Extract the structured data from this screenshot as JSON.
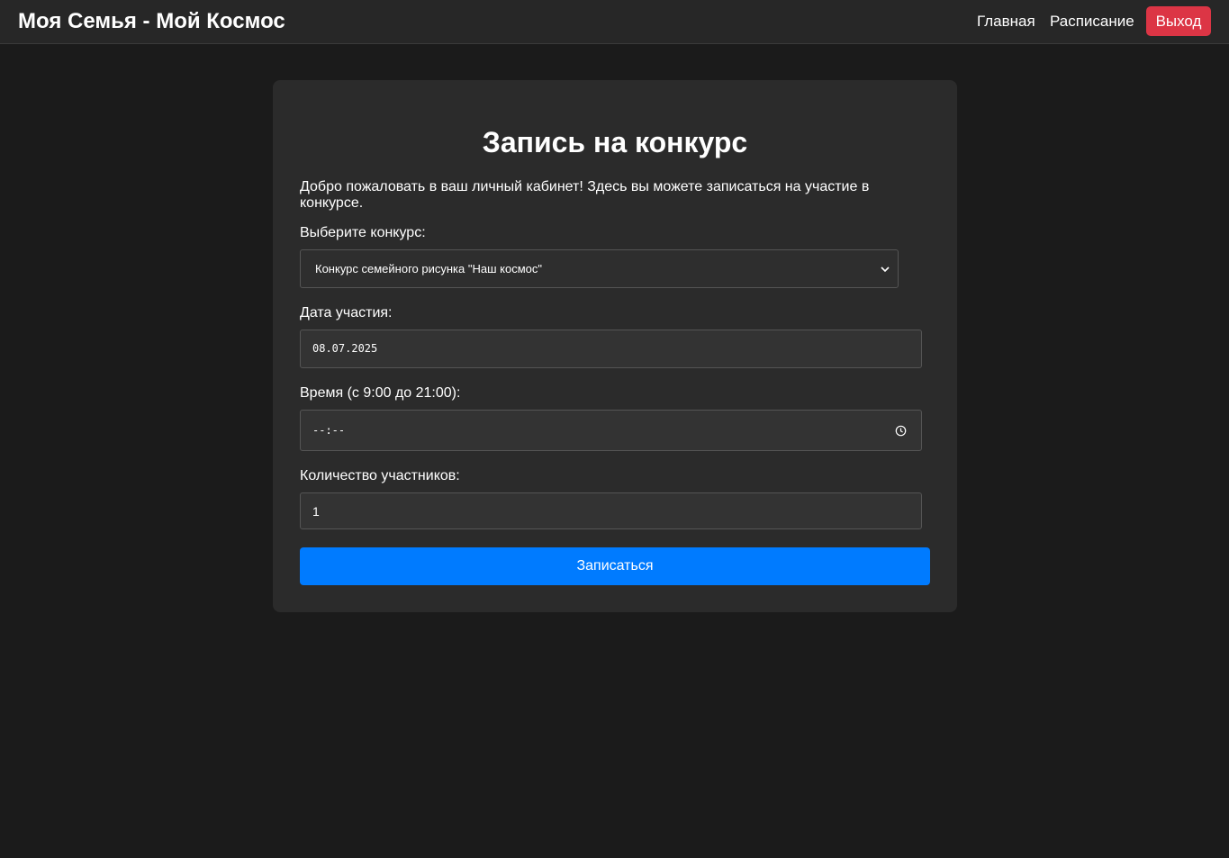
{
  "header": {
    "brand": "Моя Семья - Мой Космос",
    "nav": {
      "home_label": "Главная",
      "schedule_label": "Расписание",
      "logout_label": "Выход"
    }
  },
  "form": {
    "title": "Запись на конкурс",
    "intro": "Добро пожаловать в ваш личный кабинет! Здесь вы можете записаться на участие в конкурсе.",
    "contest": {
      "label": "Выберите конкурс:",
      "selected": "Конкурс семейного рисунка \"Наш космос\""
    },
    "date": {
      "label": "Дата участия:",
      "value": "08.07.2025"
    },
    "time": {
      "label": "Время (с 9:00 до 21:00):",
      "value": "--:--"
    },
    "participants": {
      "label": "Количество участников:",
      "value": "1"
    },
    "submit_label": "Записаться"
  },
  "colors": {
    "page_bg": "#1b1b1b",
    "navbar_bg": "#272727",
    "card_bg": "#2b2b2b",
    "primary": "#007bff",
    "danger": "#dc3545"
  },
  "icons": {
    "select_chevron": "chevron-down-icon",
    "time_picker": "clock-icon"
  }
}
